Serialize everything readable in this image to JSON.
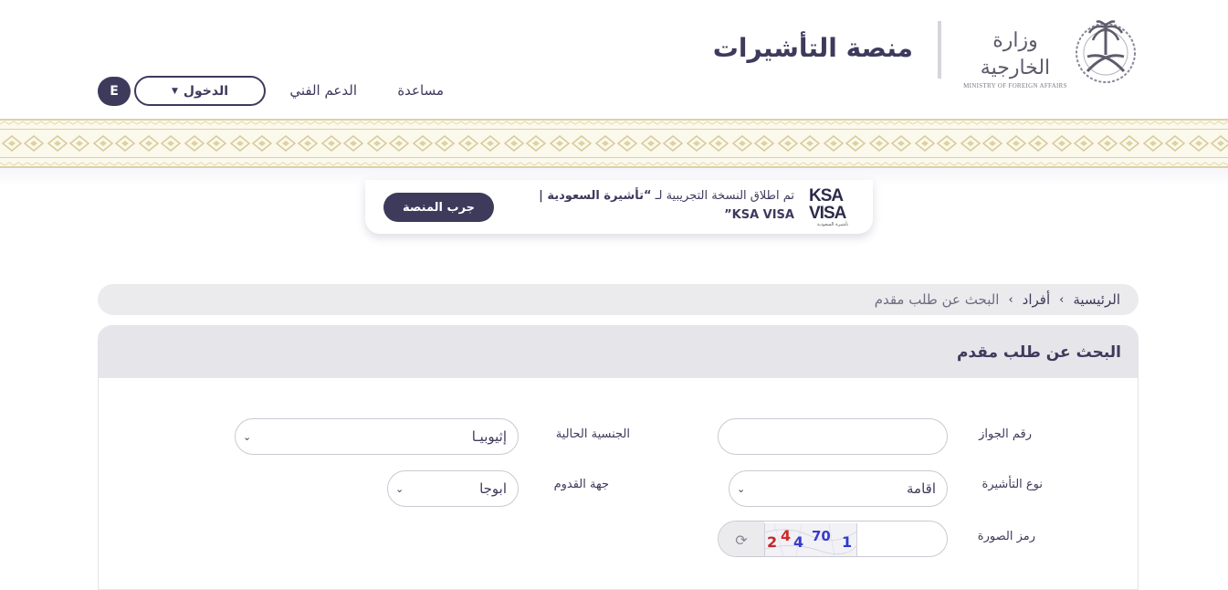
{
  "header": {
    "ministry_ar": "وزارة الخارجية",
    "ministry_en": "MINISTRY OF FOREIGN AFFAIRS",
    "platform_title": "منصة التأشيرات",
    "nav": {
      "help": "مساعدة",
      "support": "الدعم الفني",
      "login": "الدخول",
      "lang": "E"
    }
  },
  "announcement": {
    "logo_line1": "KSA",
    "logo_line2": "VISA",
    "logo_tag": "تأشيرة السعودية",
    "text_prefix": "تم اطلاق النسخة التجريبية لـ ",
    "text_highlight": "“تأشيرة السعودية |",
    "text_suffix": "KSA VISA”",
    "try_button": "جرب المنصة"
  },
  "breadcrumb": {
    "items": [
      "الرئيسية",
      "أفراد",
      "البحث عن طلب مقدم"
    ]
  },
  "panel": {
    "title": "البحث عن طلب مقدم",
    "fields": {
      "passport_label": "رقم الجواز",
      "passport_value": "",
      "nationality_label": "الجنسية الحالية",
      "nationality_value": "إثيوبيـا",
      "visa_type_label": "نوع التأشيرة",
      "visa_type_value": "اقامة",
      "arrival_label": "جهة القدوم",
      "arrival_value": "ابوجا",
      "captcha_label": "رمز الصورة",
      "captcha_value": ""
    },
    "captcha_text": "24470 1"
  },
  "colors": {
    "primary": "#3d3a5c",
    "band": "#fbf8ec",
    "band_pattern": "#ddd2a3",
    "panel_head": "#e5e5ea"
  },
  "icons": [
    "emblem-icon",
    "chevron-down-icon",
    "refresh-icon",
    "chevron-left-icon"
  ]
}
